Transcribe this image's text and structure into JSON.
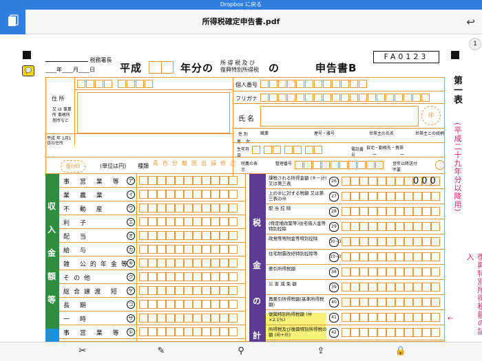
{
  "banner": {
    "text": "Dropbox に戻る"
  },
  "toolbar": {
    "title": "所得税確定申告書.pdf",
    "back_icon": "undo-arrow-icon",
    "left_icon": "document-icon"
  },
  "page_number": "1",
  "header": {
    "tax_office": "税務署長",
    "date_fields": "____年____月____日",
    "heisei": "平成",
    "year_suffix": "年分の",
    "tax_type_line1": "所 得 税 及 び",
    "tax_type_line2": "復興特別所得税",
    "no": "の",
    "form_name": "申告書B",
    "form_code": "FA0123"
  },
  "form": {
    "address_label": "住 所",
    "address_note": "又 は 事業所 事務所 居所など",
    "personal_number": "個人番号",
    "furigana": "フリガナ",
    "name_label": "氏 名",
    "seal": "印",
    "sex": "性 別",
    "male": "男",
    "female": "女",
    "occupation": "職業",
    "trade_name": "屋号・雅号",
    "head_name": "世帯主の氏名",
    "head_relation": "世帯主との続柄",
    "birth": "生年月日",
    "phone": "電話番号",
    "phone_note": "自宅・勤務先・携帯",
    "jan1_address": "平成 年 1月1日の住所",
    "receipt": "受付印",
    "unit": "(単位は円)",
    "kind_label": "種類",
    "kinds": [
      "青",
      "色",
      "分",
      "離",
      "国",
      "出",
      "損",
      "修",
      "正"
    ],
    "special": "特農の表示",
    "seiri": "整理番号",
    "next_year": "翌年以降送付不要"
  },
  "income": {
    "section_chars": [
      "収",
      "入",
      "金",
      "額",
      "等"
    ],
    "rows": [
      {
        "label": "事 営 業 等",
        "mark": "ア"
      },
      {
        "label": "業 農 業",
        "mark": "イ"
      },
      {
        "label": "不 動 産",
        "mark": "ウ"
      },
      {
        "label": "利 子",
        "mark": "エ"
      },
      {
        "label": "配 当",
        "mark": "オ"
      },
      {
        "label": "給 与",
        "mark": "カ"
      },
      {
        "label": "雑 公的年金等",
        "mark": "キ"
      },
      {
        "label": "その他",
        "mark": "ク"
      },
      {
        "label": "総合譲渡 短 期",
        "mark": "ケ"
      },
      {
        "label": "長 期",
        "mark": "コ"
      },
      {
        "label": "一 時",
        "mark": "サ"
      },
      {
        "label": "事 営 業 等",
        "mark": "①"
      }
    ]
  },
  "tax": {
    "section_chars": [
      "税",
      "金",
      "の",
      "計"
    ],
    "rows": [
      {
        "label": "課税される所得金額 (⑨－㉕)又は第三表",
        "mark": "26",
        "value": "000"
      },
      {
        "label": "上の㉖に対する税額 又は第三表の㊻",
        "mark": "27",
        "value": ""
      },
      {
        "label": "配 当 控 除",
        "mark": "28",
        "value": ""
      },
      {
        "label": "(特定増改築等)住宅借入金等特別控除",
        "mark": "29",
        "value": ""
      },
      {
        "label": "政党等寄附金等特別控除",
        "mark": "30~32",
        "value": ""
      },
      {
        "label": "住宅耐震改修特別控除等",
        "mark": "33~37",
        "value": ""
      },
      {
        "label": "差引所得税額",
        "mark": "38",
        "value": ""
      },
      {
        "label": "災 害 減 免 額",
        "mark": "39",
        "value": ""
      },
      {
        "label": "再差引所得税額(基準所得税額)",
        "mark": "40",
        "value": ""
      },
      {
        "label": "復興特別所得税額 (㊵×2.1%)",
        "mark": "41",
        "value": ""
      },
      {
        "label": "所得税及び復興特別所得税の額 (㊵+㊶)",
        "mark": "42",
        "value": ""
      }
    ]
  },
  "right_margin": {
    "dai": "第一表",
    "period": "(平成二十九年分以降用)",
    "note": "復興特別所得税額の記入"
  },
  "bottom_toolbar": {
    "icons": [
      "export-icon",
      "annotate-icon",
      "search-icon",
      "share-icon",
      "lock-icon"
    ]
  },
  "colors": {
    "accent": "#2f7fe0",
    "green": "#2e8d3e",
    "purple": "#5b3c92",
    "pink": "#d91f6a",
    "orange": "#e59a3a"
  }
}
